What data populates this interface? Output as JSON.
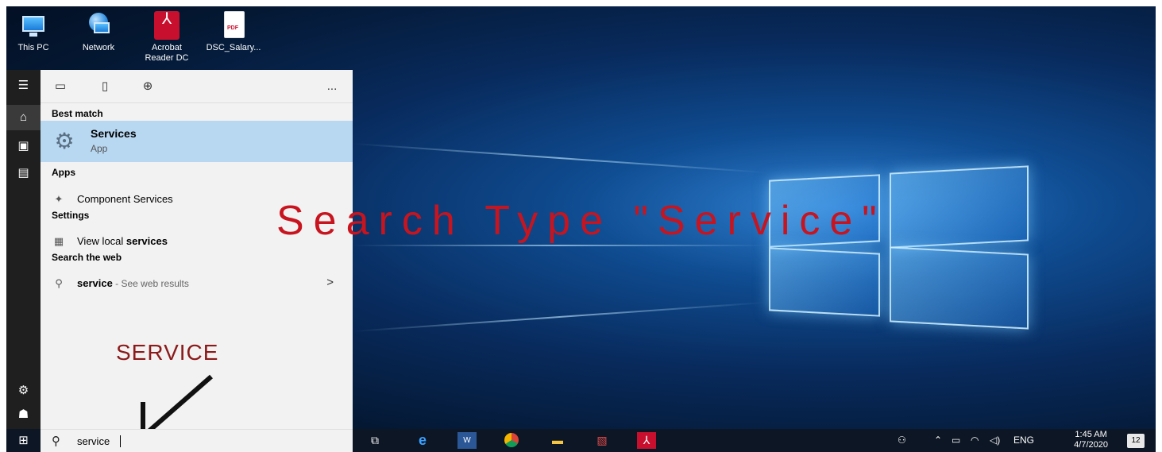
{
  "desktop": {
    "icons": [
      {
        "label": "This PC",
        "icon": "this-pc-icon"
      },
      {
        "label": "Network",
        "icon": "network-icon"
      },
      {
        "label": "Acrobat Reader DC",
        "icon": "acrobat-icon"
      },
      {
        "label": "DSC_Salary...",
        "icon": "pdf-file-icon"
      }
    ],
    "pdf_badge": "PDF"
  },
  "start_menu": {
    "rail": [
      "hamburger-icon",
      "home-icon",
      "documents-icon",
      "apps-icon",
      "settings-icon",
      "user-icon"
    ],
    "top_bar": {
      "more": "..."
    },
    "best_match": {
      "heading": "Best match",
      "title": "Services",
      "subtitle": "App"
    },
    "apps": {
      "heading": "Apps",
      "item_prefix": "Component ",
      "item_bold": "Services"
    },
    "settings": {
      "heading": "Settings",
      "item_prefix": "View local ",
      "item_bold": "services"
    },
    "web": {
      "heading": "Search the web",
      "query": "service",
      "hint": " - See web results",
      "chevron": ">"
    },
    "search_value": "service"
  },
  "annotations": {
    "service_label": "SERVICE",
    "headline": "Search Type \"Service\""
  },
  "taskbar": {
    "apps": [
      "task-view-icon",
      "edge-icon",
      "word-icon",
      "chrome-icon",
      "file-explorer-icon",
      "photos-icon",
      "acrobat-icon"
    ],
    "language": "ENG",
    "time": "1:45 AM",
    "date": "4/7/2020",
    "notification_count": "12"
  },
  "colors": {
    "accent": "#b8d8f2",
    "annotation_red": "#c8141e",
    "taskbar": "#0d1624"
  }
}
